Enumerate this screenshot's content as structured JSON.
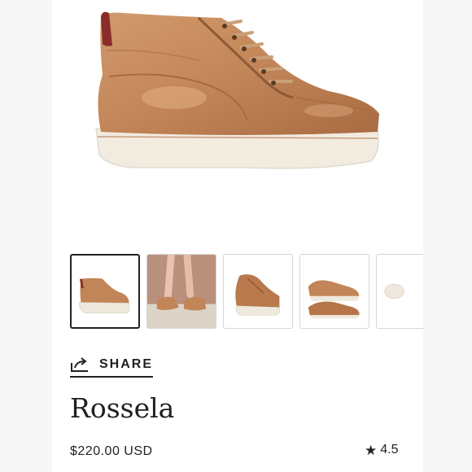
{
  "product": {
    "name": "Rossela",
    "price": "$220.00 USD",
    "rating": "4.5"
  },
  "actions": {
    "share_label": "SHARE"
  },
  "gallery": {
    "selected_index": 0,
    "thumbnails": [
      {
        "name": "side view"
      },
      {
        "name": "worn on feet"
      },
      {
        "name": "three-quarter view"
      },
      {
        "name": "top view pair"
      },
      {
        "name": "sole view"
      }
    ]
  },
  "colors": {
    "leather": "#c28558",
    "sole": "#efe8dc",
    "text": "#222222"
  },
  "icons": {
    "share": "share-arrow-icon",
    "star": "star-icon"
  }
}
